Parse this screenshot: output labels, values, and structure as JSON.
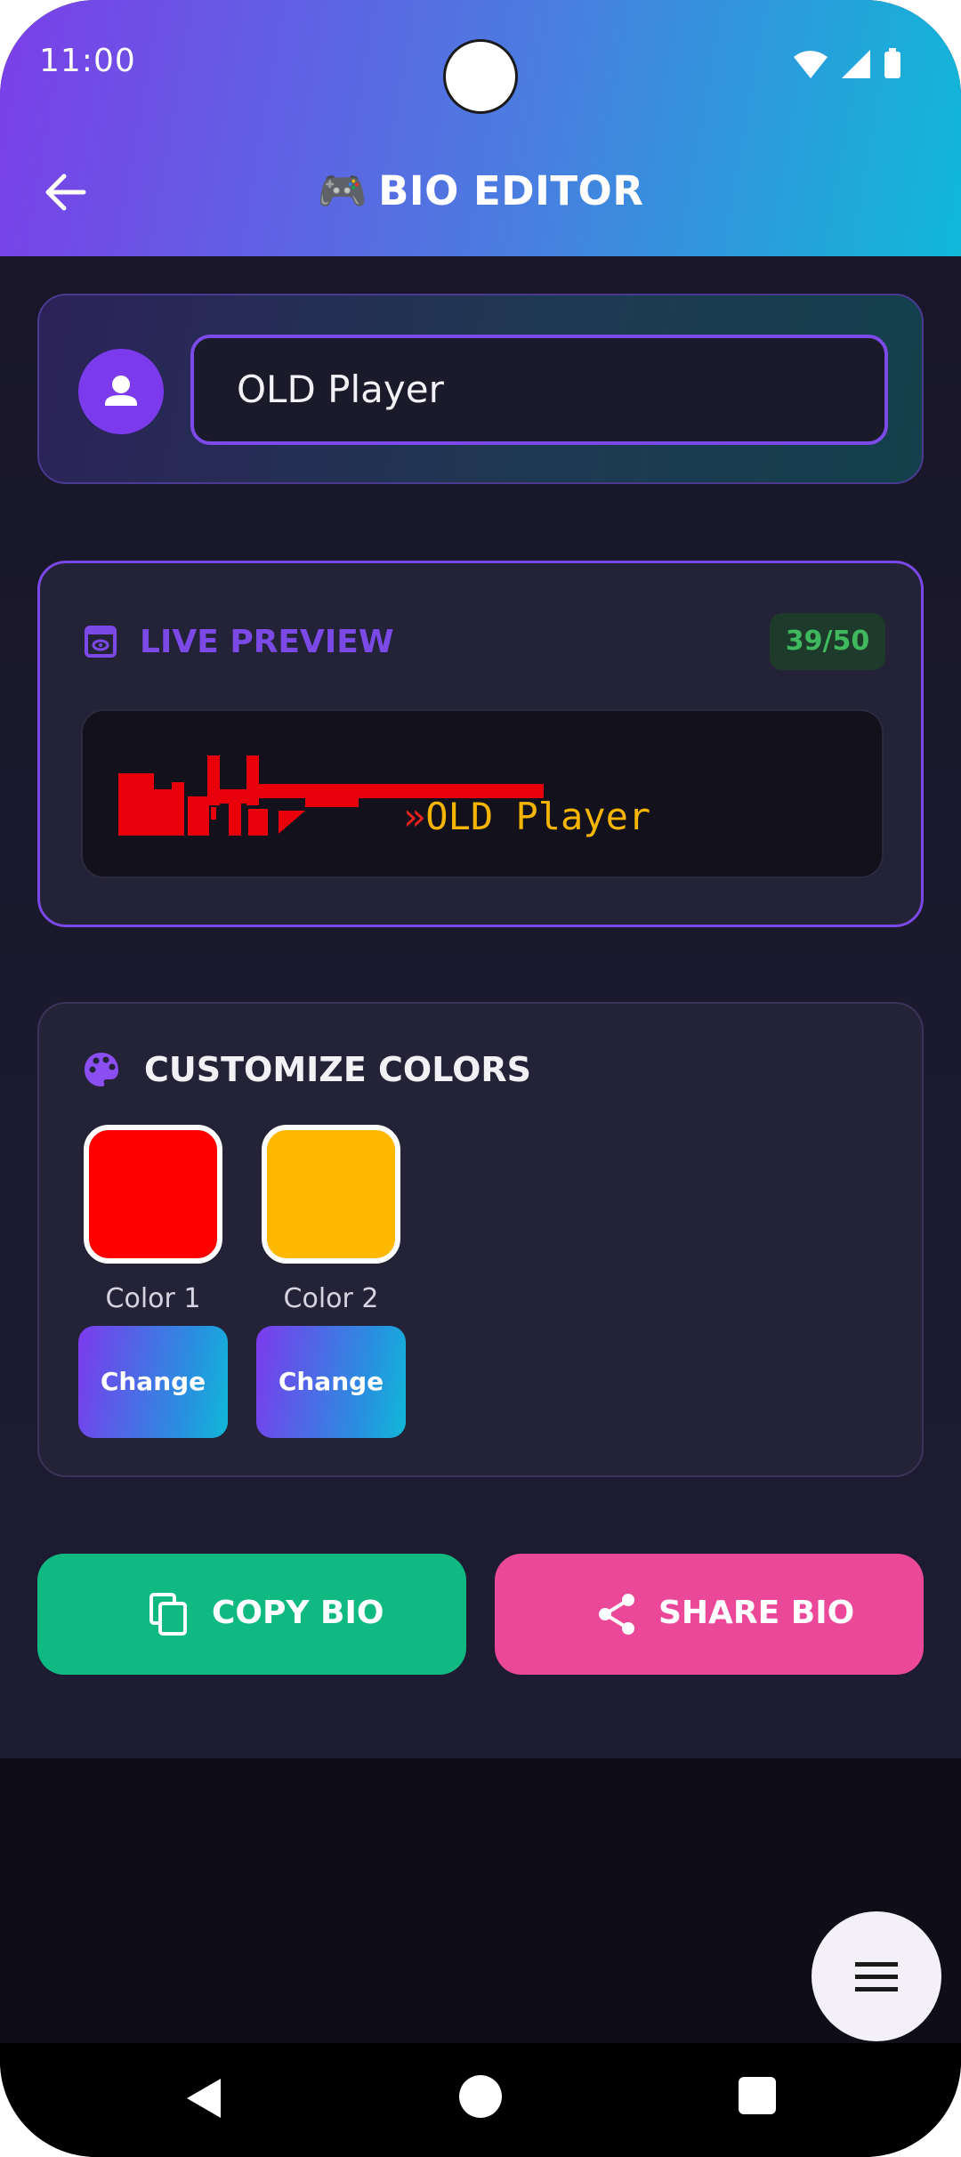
{
  "status_bar": {
    "time": "11:00"
  },
  "app_bar": {
    "title": "BIO EDITOR",
    "emoji": "🎮"
  },
  "name_field": {
    "value": "OLD Player"
  },
  "preview": {
    "title": "LIVE PREVIEW",
    "char_count": "39/50",
    "arrow": "»",
    "name_text": "OLD Player",
    "arrow_color": "#e8231c",
    "name_color": "#f5b400"
  },
  "colors": {
    "title": "CUSTOMIZE COLORS",
    "items": [
      {
        "label": "Color 1",
        "value": "#ff0000",
        "button": "Change"
      },
      {
        "label": "Color 2",
        "value": "#ffb800",
        "button": "Change"
      }
    ]
  },
  "actions": {
    "copy": "COPY BIO",
    "share": "SHARE BIO"
  },
  "theme": {
    "accent_purple": "#7c3aed",
    "accent_cyan": "#10b8d8",
    "copy_green": "#10b981",
    "share_pink": "#ec4899"
  }
}
